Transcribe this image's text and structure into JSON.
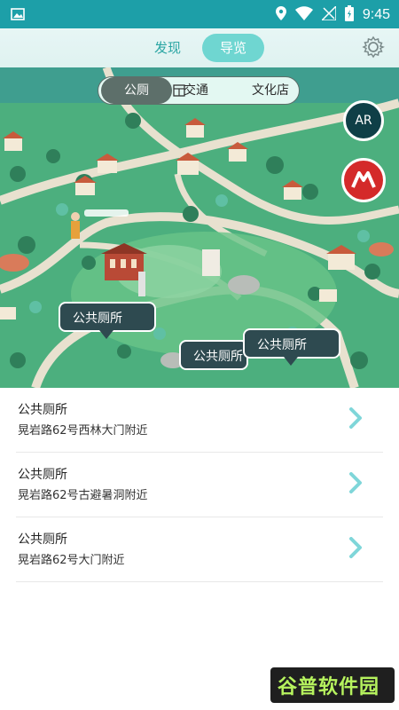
{
  "status_bar": {
    "time": "9:45"
  },
  "header": {
    "tabs": [
      {
        "label": "发现",
        "active": false
      },
      {
        "label": "导览",
        "active": true
      }
    ]
  },
  "filters": [
    {
      "label": "公厕",
      "active": true
    },
    {
      "label": "交通",
      "active": false
    },
    {
      "label": "文化店",
      "active": false
    }
  ],
  "map": {
    "ar_label": "AR",
    "bubbles": [
      "公共厕所",
      "公共厕所",
      "公共厕所"
    ]
  },
  "list": [
    {
      "title": "公共厕所",
      "address": "晃岩路62号西林大门附近"
    },
    {
      "title": "公共厕所",
      "address": "晃岩路62号古避暑洞附近"
    },
    {
      "title": "公共厕所",
      "address": "晃岩路62号大门附近"
    }
  ],
  "watermark": {
    "text": "谷普软件园"
  },
  "colors": {
    "accent": "#1d9fa8",
    "active_tab": "#6fd6d1",
    "filter_active": "#5d6f6a",
    "chevron": "#7fd6d9"
  }
}
